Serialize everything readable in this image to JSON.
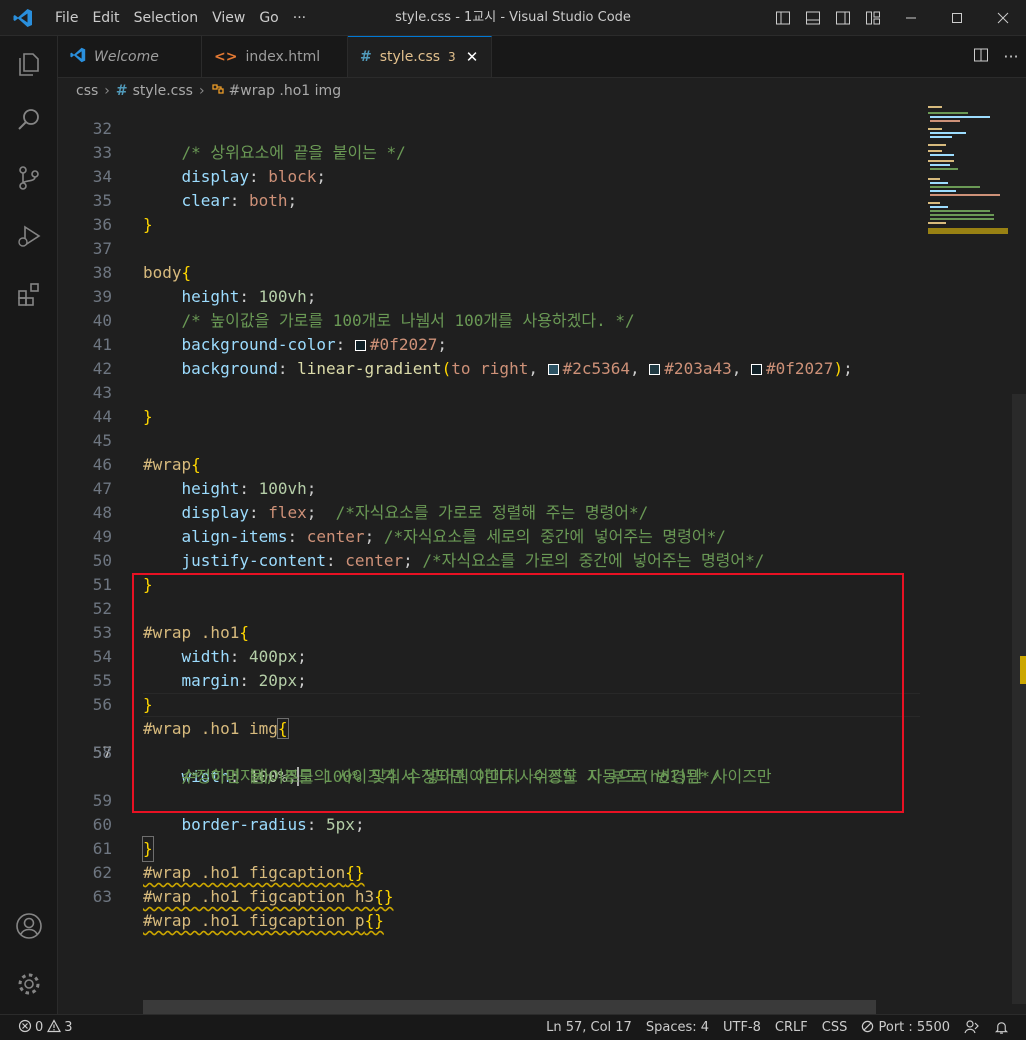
{
  "titlebar": {
    "menu": [
      "File",
      "Edit",
      "Selection",
      "View",
      "Go",
      "···"
    ],
    "title": "style.css - 1교시 - Visual Studio Code"
  },
  "tabs": [
    {
      "label": "Welcome",
      "icon": "vscode-icon"
    },
    {
      "label": "index.html",
      "icon": "html-icon",
      "glyph": "<>"
    },
    {
      "label": "style.css",
      "icon": "css-icon",
      "glyph": "#",
      "badge": "3"
    }
  ],
  "breadcrumb": {
    "folder": "css",
    "file": "style.css",
    "symbol": "#wrap .ho1 img"
  },
  "colors": {
    "accent": "#0078d4",
    "selection_box": "#e81123",
    "modified": "#e2c08d"
  },
  "editor": {
    "lines": {
      "l32": {
        "num": "32",
        "code": "    /* 상위요소에 끝을 붙이는 */"
      },
      "l33": {
        "num": "33",
        "prop": "display",
        "val": "block"
      },
      "l34": {
        "num": "34",
        "prop": "clear",
        "val": "both"
      },
      "l35": {
        "num": "35"
      },
      "l36": {
        "num": "36"
      },
      "l37": {
        "num": "37",
        "sel": "body"
      },
      "l38": {
        "num": "38",
        "prop": "height",
        "val": "100vh"
      },
      "l39": {
        "num": "39",
        "com": "/* 높이값을 가로를 100개로 나뉌서 100개를 사용하겠다. */"
      },
      "l40": {
        "num": "40",
        "prop": "background-color",
        "val": "#0f2027"
      },
      "l41": {
        "num": "41",
        "prop": "background",
        "fn": "linear-gradient",
        "dir": "to right",
        "c1": "#2c5364",
        "c2": "#203a43",
        "c3": "#0f2027"
      },
      "l42": {
        "num": "42"
      },
      "l43": {
        "num": "43"
      },
      "l44": {
        "num": "44"
      },
      "l45": {
        "num": "45",
        "sel": "#wrap"
      },
      "l46": {
        "num": "46",
        "prop": "height",
        "val": "100vh"
      },
      "l47": {
        "num": "47",
        "prop": "display",
        "val": "flex",
        "com": "/*자식요소를 가로로 정렬해 주는 명령어*/"
      },
      "l48": {
        "num": "48",
        "prop": "align-items",
        "val": "center",
        "com": "/*자식요소를 세로의 중간에 넣어주는 명령어*/"
      },
      "l49": {
        "num": "49",
        "prop": "justify-content",
        "val": "center",
        "com": "/*자식요소를 가로의 중간에 넣어주는 명령어*/"
      },
      "l50": {
        "num": "50"
      },
      "l51": {
        "num": "51"
      },
      "l52": {
        "num": "52",
        "sel": "#wrap .ho1"
      },
      "l53": {
        "num": "53",
        "prop": "width",
        "val": "400px"
      },
      "l54": {
        "num": "54",
        "prop": "margin",
        "val": "20px"
      },
      "l55": {
        "num": "55"
      },
      "l56": {
        "num": "56",
        "sel": "#wrap .ho1 img"
      },
      "l57": {
        "num": "57",
        "prop": "width",
        "val": "100%"
      },
      "l58": {
        "num": "58",
        "com": "/* 이미지사이즈를 100% 맞춰서 넣어줘야한다. 수정할 시 부모(ho1)만 사이즈만",
        "com2": "수정하면 됨, 부모의 사이즈가 수정되면 이미지사이즈도 자동으로 변경됨*/"
      },
      "l59": {
        "num": "59",
        "prop": "border-radius",
        "val": "5px"
      },
      "l60": {
        "num": "60"
      },
      "l61": {
        "num": "61",
        "sel": "#wrap .ho1 figcaption"
      },
      "l62": {
        "num": "62",
        "sel": "#wrap .ho1 figcaption h3"
      },
      "l63": {
        "num": "63",
        "sel": "#wrap .ho1 figcaption p"
      }
    }
  },
  "statusbar": {
    "errors": "0",
    "warnings": "3",
    "position": "Ln 57, Col 17",
    "spaces": "Spaces: 4",
    "encoding": "UTF-8",
    "eol": "CRLF",
    "language": "CSS",
    "port": "Port : 5500"
  }
}
